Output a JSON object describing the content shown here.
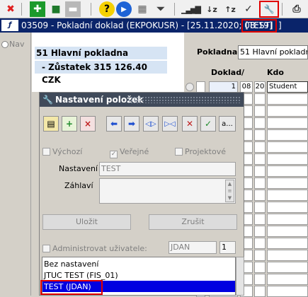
{
  "toolbar": {
    "icons": [
      "close-icon",
      "add-icon",
      "save-icon",
      "delete-icon",
      "help-icon",
      "play-icon",
      "calendar-icon",
      "filter-icon",
      "signal-icon",
      "sort-asc-icon",
      "sort-desc-icon",
      "check-icon",
      "wrench-icon",
      "print-icon"
    ],
    "glyphs": {
      "close": "✖",
      "add": "✚",
      "save": "■",
      "delete": "▬",
      "help": "?",
      "play": "▶",
      "calendar": "▦",
      "filter": "⏷",
      "signal": "▁▃▅▇",
      "sort_asc": "↓z",
      "sort_desc": "↑z",
      "check": "✓",
      "wrench": "🔧",
      "print": "⎙"
    }
  },
  "window": {
    "logo": "ƒ",
    "title": "03509 - Pokladní doklad (EKPOKUSR) - [25.11.2020; 08:19]",
    "title_tag": "[TEST]",
    "title_tail": "]"
  },
  "left": {
    "nav_label": "Nav"
  },
  "main": {
    "cash_name": "51 Hlavní pokladna",
    "balance": "- Zůstatek 315 126.40 CZK"
  },
  "right": {
    "pokladna_label": "Pokladna",
    "pokladna_value": "51 Hlavní pokladna",
    "columns": {
      "doklad": "Doklad",
      "slash": "/",
      "kdo": "Kdo"
    },
    "row1": {
      "doklad": "1",
      "c2": "08",
      "c3": "20",
      "kdo": "Student"
    }
  },
  "dialog": {
    "title": "Nastavení položek",
    "buttons": [
      "cardfile-lock-icon",
      "cardfile-add-icon",
      "cardfile-delete-icon",
      "arrow-left-icon",
      "arrow-right-icon",
      "expand-icon",
      "collapse-icon",
      "remove-icon",
      "check-edit-icon",
      "more-button"
    ],
    "more_label": "a...",
    "checkboxes": {
      "vychozi": "Výchozí",
      "verejne": "Veřejné",
      "projektove": "Projektové"
    },
    "nastaveni_label": "Nastavení",
    "nastaveni_value": "TEST",
    "zahlavi_label": "Záhlaví",
    "save_label": "Uložit",
    "cancel_label": "Zrušit",
    "admin_label": "Administrovat uživatele:",
    "admin_user": "JDAN",
    "admin_num": "1",
    "list": [
      "Bez nastavení",
      "JTUC TEST   (FIS_01)",
      "TEST   (JDAN)"
    ]
  }
}
